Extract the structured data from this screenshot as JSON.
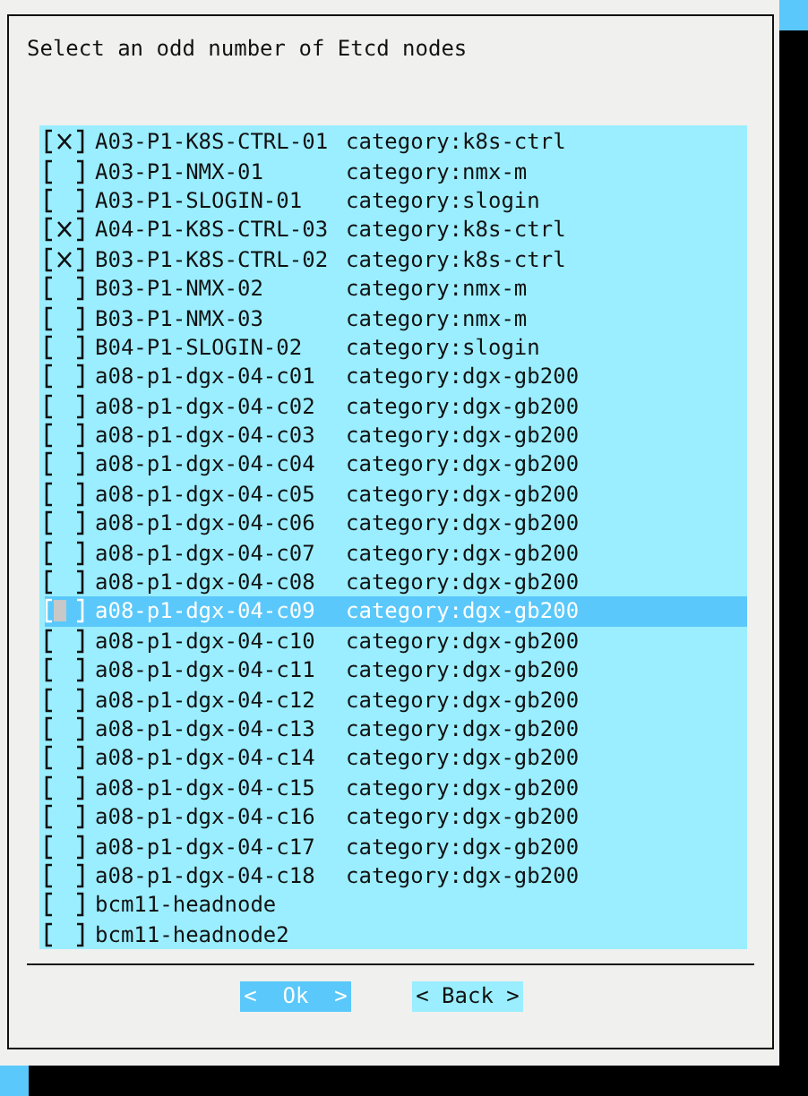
{
  "dialog": {
    "prompt": "Select an odd number of Etcd nodes"
  },
  "nodes": [
    {
      "name": "A03-P1-K8S-CTRL-01",
      "category": "category:k8s-ctrl",
      "checked": true,
      "selected": false
    },
    {
      "name": "A03-P1-NMX-01",
      "category": "category:nmx-m",
      "checked": false,
      "selected": false
    },
    {
      "name": "A03-P1-SLOGIN-01",
      "category": "category:slogin",
      "checked": false,
      "selected": false
    },
    {
      "name": "A04-P1-K8S-CTRL-03",
      "category": "category:k8s-ctrl",
      "checked": true,
      "selected": false
    },
    {
      "name": "B03-P1-K8S-CTRL-02",
      "category": "category:k8s-ctrl",
      "checked": true,
      "selected": false
    },
    {
      "name": "B03-P1-NMX-02",
      "category": "category:nmx-m",
      "checked": false,
      "selected": false
    },
    {
      "name": "B03-P1-NMX-03",
      "category": "category:nmx-m",
      "checked": false,
      "selected": false
    },
    {
      "name": "B04-P1-SLOGIN-02",
      "category": "category:slogin",
      "checked": false,
      "selected": false
    },
    {
      "name": "a08-p1-dgx-04-c01",
      "category": "category:dgx-gb200",
      "checked": false,
      "selected": false
    },
    {
      "name": "a08-p1-dgx-04-c02",
      "category": "category:dgx-gb200",
      "checked": false,
      "selected": false
    },
    {
      "name": "a08-p1-dgx-04-c03",
      "category": "category:dgx-gb200",
      "checked": false,
      "selected": false
    },
    {
      "name": "a08-p1-dgx-04-c04",
      "category": "category:dgx-gb200",
      "checked": false,
      "selected": false
    },
    {
      "name": "a08-p1-dgx-04-c05",
      "category": "category:dgx-gb200",
      "checked": false,
      "selected": false
    },
    {
      "name": "a08-p1-dgx-04-c06",
      "category": "category:dgx-gb200",
      "checked": false,
      "selected": false
    },
    {
      "name": "a08-p1-dgx-04-c07",
      "category": "category:dgx-gb200",
      "checked": false,
      "selected": false
    },
    {
      "name": "a08-p1-dgx-04-c08",
      "category": "category:dgx-gb200",
      "checked": false,
      "selected": false
    },
    {
      "name": "a08-p1-dgx-04-c09",
      "category": "category:dgx-gb200",
      "checked": false,
      "selected": true
    },
    {
      "name": "a08-p1-dgx-04-c10",
      "category": "category:dgx-gb200",
      "checked": false,
      "selected": false
    },
    {
      "name": "a08-p1-dgx-04-c11",
      "category": "category:dgx-gb200",
      "checked": false,
      "selected": false
    },
    {
      "name": "a08-p1-dgx-04-c12",
      "category": "category:dgx-gb200",
      "checked": false,
      "selected": false
    },
    {
      "name": "a08-p1-dgx-04-c13",
      "category": "category:dgx-gb200",
      "checked": false,
      "selected": false
    },
    {
      "name": "a08-p1-dgx-04-c14",
      "category": "category:dgx-gb200",
      "checked": false,
      "selected": false
    },
    {
      "name": "a08-p1-dgx-04-c15",
      "category": "category:dgx-gb200",
      "checked": false,
      "selected": false
    },
    {
      "name": "a08-p1-dgx-04-c16",
      "category": "category:dgx-gb200",
      "checked": false,
      "selected": false
    },
    {
      "name": "a08-p1-dgx-04-c17",
      "category": "category:dgx-gb200",
      "checked": false,
      "selected": false
    },
    {
      "name": "a08-p1-dgx-04-c18",
      "category": "category:dgx-gb200",
      "checked": false,
      "selected": false
    },
    {
      "name": "bcm11-headnode",
      "checked": false,
      "selected": false
    },
    {
      "name": "bcm11-headnode2",
      "checked": false,
      "selected": false
    }
  ],
  "buttons": [
    {
      "label": "<  Ok  >",
      "selected": true
    },
    {
      "label": "< Back >",
      "selected": false
    }
  ]
}
